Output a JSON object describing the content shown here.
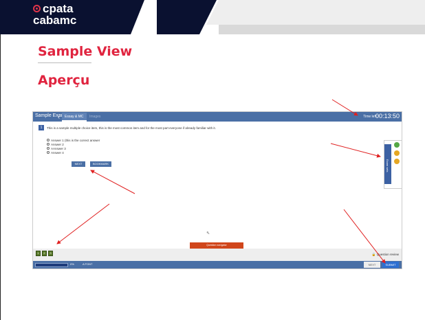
{
  "brand": {
    "line1": "cpata",
    "line2": "cabamc",
    "accent_color": "#e0243f",
    "bar_color": "#0a1130"
  },
  "headings": {
    "en": "Sample View",
    "fr": "Aperçu"
  },
  "exam": {
    "title": "Sample Exam",
    "tabs": [
      {
        "label": "Essay & MC",
        "active": true
      },
      {
        "label": "Images",
        "active": false
      }
    ],
    "time_left_label": "Time left :",
    "time_left_value": "00:13:50",
    "question": {
      "number": "1",
      "text": "This is a sample multiple choice item, this is the most common item and for the most part everyone if already familiar with it.",
      "answers": [
        "Answer 1 (this is the correct answer",
        "Answer 2",
        "AAnswer 3",
        "Answer 4"
      ]
    },
    "buttons": {
      "next": "NEXT",
      "bookmark": "BOOKMARK"
    },
    "side_panel": {
      "label": "Exam sets",
      "icons": [
        "green-circle-icon",
        "yellow-circle-icon",
        "yellow-circle-icon"
      ]
    },
    "question_navigator": "Question navigator",
    "nav_squares": [
      "1",
      "2",
      "3"
    ],
    "question_review": "Question review",
    "footer": {
      "progress_percent": "0%",
      "progress_value": 0.95,
      "font_label": "A FONT",
      "next": "NEXT",
      "submit": "SUBMIT"
    }
  }
}
